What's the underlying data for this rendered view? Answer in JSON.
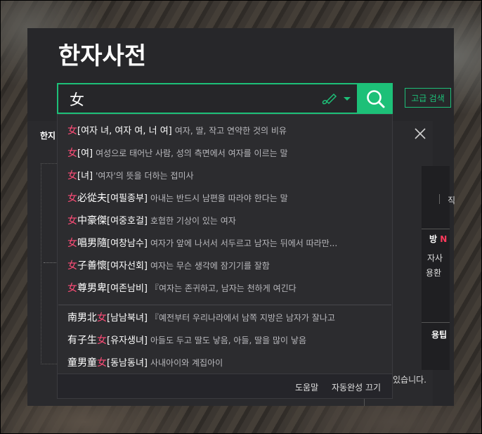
{
  "page": {
    "title": "한자사전",
    "search": {
      "value": "女",
      "button_icon": "search-icon",
      "handwrite_icon": "handwriting-pen-icon"
    },
    "advanced_search_label": "고급 검색"
  },
  "background": {
    "tab_label": "한지",
    "right_texts": [
      "직",
      "방",
      "N",
      "자사",
      "용환",
      "용팁",
      "있습니다."
    ],
    "close_icon": "close-icon"
  },
  "autocomplete": {
    "items": [
      {
        "pre": "",
        "hl": "女",
        "post": "",
        "reading": "[여자 녀, 여자 여, 너 여]",
        "meaning": "여자, 딸, 작고 연약한 것의 비유"
      },
      {
        "pre": "",
        "hl": "女",
        "post": "",
        "reading": "[여]",
        "meaning": "여성으로 태어난 사람, 성의 측면에서 여자를 이르는 말"
      },
      {
        "pre": "",
        "hl": "女",
        "post": "",
        "reading": "[녀]",
        "meaning": "'여자'의 뜻을 더하는 접미사"
      },
      {
        "pre": "",
        "hl": "女",
        "post": "必從夫",
        "reading": "[여필종부]",
        "meaning": "아내는 반드시 남편을 따라야 한다는 말"
      },
      {
        "pre": "",
        "hl": "女",
        "post": "中豪傑",
        "reading": "[여중호걸]",
        "meaning": "호협한 기상이 있는 여자"
      },
      {
        "pre": "",
        "hl": "女",
        "post": "唱男隨",
        "reading": "[여창남수]",
        "meaning": "여자가 앞에 나서서 서두르고 남자는 뒤에서 따라만..."
      },
      {
        "pre": "",
        "hl": "女",
        "post": "子善懷",
        "reading": "[여자선회]",
        "meaning": "여자는 무슨 생각에 잠기기를 잘함"
      },
      {
        "pre": "",
        "hl": "女",
        "post": "尊男卑",
        "reading": "[여존남비]",
        "meaning": "『여자는 존귀하고, 남자는 천하게 여긴다"
      },
      {
        "pre": "南男北",
        "hl": "女",
        "post": "",
        "reading": "[남남북녀]",
        "meaning": "『예전부터 우리나라에서 남쪽 지방은 남자가 잘나고"
      },
      {
        "pre": "有子生",
        "hl": "女",
        "post": "",
        "reading": "[유자생녀]",
        "meaning": "아들도 두고 딸도 낳음, 아들, 딸을 많이 낳음"
      },
      {
        "pre": "童男童",
        "hl": "女",
        "post": "",
        "reading": "[동남동녀]",
        "meaning": "사내아이와 계집아이"
      }
    ],
    "footer": {
      "help": "도움말",
      "toggle": "자동완성 끄기"
    }
  }
}
